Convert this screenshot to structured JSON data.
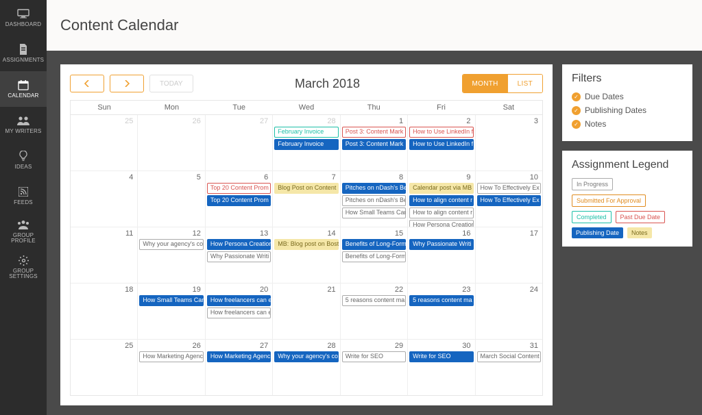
{
  "sidebar": {
    "items": [
      {
        "label": "DASHBOARD",
        "icon": "monitor"
      },
      {
        "label": "ASSIGNMENTS",
        "icon": "doc"
      },
      {
        "label": "CALENDAR",
        "icon": "calendar",
        "active": true
      },
      {
        "label": "MY WRITERS",
        "icon": "users"
      },
      {
        "label": "IDEAS",
        "icon": "bulb"
      },
      {
        "label": "FEEDS",
        "icon": "rss"
      },
      {
        "label": "GROUP PROFILE",
        "icon": "group"
      },
      {
        "label": "GROUP SETTINGS",
        "icon": "gear"
      }
    ]
  },
  "header": {
    "title": "Content Calendar"
  },
  "calendar": {
    "month_title": "March 2018",
    "today_label": "TODAY",
    "view": {
      "month": "MONTH",
      "list": "LIST",
      "active": "month"
    },
    "dow": [
      "Sun",
      "Mon",
      "Tue",
      "Wed",
      "Thu",
      "Fri",
      "Sat"
    ],
    "weeks": [
      [
        {
          "num": 25,
          "other": true,
          "events": []
        },
        {
          "num": 26,
          "other": true,
          "events": []
        },
        {
          "num": 27,
          "other": true,
          "events": []
        },
        {
          "num": 28,
          "other": true,
          "events": [
            {
              "t": "February Invoice",
              "k": "completed"
            },
            {
              "t": "February Invoice",
              "k": "publishing"
            }
          ]
        },
        {
          "num": 1,
          "events": [
            {
              "t": "Post 3: Content Mark",
              "k": "pastdue"
            },
            {
              "t": "Post 3: Content Mark",
              "k": "publishing"
            }
          ]
        },
        {
          "num": 2,
          "events": [
            {
              "t": "How to Use LinkedIn f",
              "k": "pastdue"
            },
            {
              "t": "How to Use LinkedIn f",
              "k": "publishing"
            }
          ]
        },
        {
          "num": 3,
          "events": []
        }
      ],
      [
        {
          "num": 4,
          "events": []
        },
        {
          "num": 5,
          "events": []
        },
        {
          "num": 6,
          "events": [
            {
              "t": "Top 20 Content Prom",
              "k": "pastdue"
            },
            {
              "t": "Top 20 Content Prom",
              "k": "publishing"
            }
          ]
        },
        {
          "num": 7,
          "events": [
            {
              "t": "Blog Post on Content",
              "k": "notes"
            }
          ]
        },
        {
          "num": 8,
          "events": [
            {
              "t": "Pitches on nDash's Be",
              "k": "publishing"
            },
            {
              "t": "Pitches on nDash's Be",
              "k": "inprogress"
            },
            {
              "t": "How Small Teams Can",
              "k": "inprogress"
            }
          ]
        },
        {
          "num": 9,
          "events": [
            {
              "t": "Calendar post via MB",
              "k": "notes"
            },
            {
              "t": "How to align content r",
              "k": "publishing"
            },
            {
              "t": "How to align content r",
              "k": "inprogress"
            },
            {
              "t": "How Persona Creation",
              "k": "inprogress"
            }
          ]
        },
        {
          "num": 10,
          "events": [
            {
              "t": "How To Effectively Ex",
              "k": "inprogress"
            },
            {
              "t": "How To Effectively Ex",
              "k": "publishing"
            }
          ]
        }
      ],
      [
        {
          "num": 11,
          "events": []
        },
        {
          "num": 12,
          "events": [
            {
              "t": "Why your agency's co",
              "k": "inprogress"
            }
          ]
        },
        {
          "num": 13,
          "events": [
            {
              "t": "How Persona Creation",
              "k": "publishing"
            },
            {
              "t": "Why Passionate Writi",
              "k": "inprogress"
            }
          ]
        },
        {
          "num": 14,
          "events": [
            {
              "t": "MB: Blog post on Bost",
              "k": "notes"
            }
          ]
        },
        {
          "num": 15,
          "events": [
            {
              "t": "Benefits of Long-Form",
              "k": "publishing"
            },
            {
              "t": "Benefits of Long-Form",
              "k": "inprogress"
            }
          ]
        },
        {
          "num": 16,
          "events": [
            {
              "t": "Why Passionate Writi",
              "k": "publishing"
            }
          ]
        },
        {
          "num": 17,
          "events": []
        }
      ],
      [
        {
          "num": 18,
          "events": []
        },
        {
          "num": 19,
          "events": [
            {
              "t": "How Small Teams Can",
              "k": "publishing"
            }
          ]
        },
        {
          "num": 20,
          "events": [
            {
              "t": "How freelancers can e",
              "k": "publishing"
            },
            {
              "t": "How freelancers can e",
              "k": "inprogress"
            }
          ]
        },
        {
          "num": 21,
          "events": []
        },
        {
          "num": 22,
          "events": [
            {
              "t": "5 reasons content ma",
              "k": "inprogress"
            }
          ]
        },
        {
          "num": 23,
          "events": [
            {
              "t": "5 reasons content ma",
              "k": "publishing"
            }
          ]
        },
        {
          "num": 24,
          "events": []
        }
      ],
      [
        {
          "num": 25,
          "events": []
        },
        {
          "num": 26,
          "events": [
            {
              "t": "How Marketing Agenc",
              "k": "inprogress"
            }
          ]
        },
        {
          "num": 27,
          "events": [
            {
              "t": "How Marketing Agenc",
              "k": "publishing"
            }
          ]
        },
        {
          "num": 28,
          "events": [
            {
              "t": "Why your agency's co",
              "k": "publishing"
            }
          ]
        },
        {
          "num": 29,
          "events": [
            {
              "t": "Write for SEO",
              "k": "inprogress"
            }
          ]
        },
        {
          "num": 30,
          "events": [
            {
              "t": "Write for SEO",
              "k": "publishing"
            }
          ]
        },
        {
          "num": 31,
          "events": [
            {
              "t": "March Social Content",
              "k": "inprogress"
            }
          ]
        }
      ]
    ]
  },
  "filters": {
    "title": "Filters",
    "items": [
      "Due Dates",
      "Publishing Dates",
      "Notes"
    ]
  },
  "legend": {
    "title": "Assignment Legend",
    "tags": [
      {
        "label": "In Progress",
        "k": "inprogress"
      },
      {
        "label": "Submitted For Approval",
        "k": "submitted"
      },
      {
        "label": "Completed",
        "k": "completed"
      },
      {
        "label": "Past Due Date",
        "k": "pastdue"
      },
      {
        "label": "Publishing Date",
        "k": "publishing"
      },
      {
        "label": "Notes",
        "k": "notes"
      }
    ]
  }
}
